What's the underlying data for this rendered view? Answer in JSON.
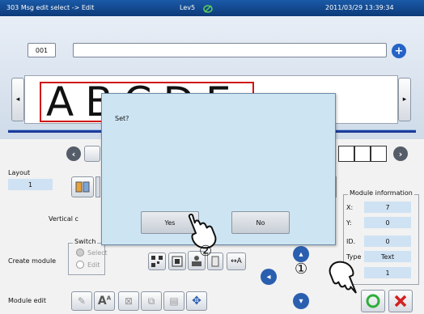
{
  "titlebar": {
    "mode": "303 Msg edit select -> Edit",
    "level": "Lev5",
    "datetime": "2011/03/29 13:39:34"
  },
  "message": {
    "number": "001",
    "text": "",
    "preview_text": "ABCDE"
  },
  "layout": {
    "label": "Layout",
    "value": "1"
  },
  "vertical": {
    "label": "Vertical c"
  },
  "switch": {
    "label": "Switch",
    "options": [
      "Select",
      "Edit"
    ]
  },
  "create_module": {
    "label": "Create module"
  },
  "module_edit": {
    "label": "Module edit"
  },
  "module_info": {
    "title": "Module information",
    "rows": [
      {
        "key": "X:",
        "value": "7"
      },
      {
        "key": "Y:",
        "value": "0"
      },
      {
        "key": "ID.",
        "value": "0"
      },
      {
        "key": "Type",
        "value": "Text"
      },
      {
        "key": "",
        "value": "1"
      }
    ]
  },
  "dialog": {
    "prompt": "Set?",
    "yes_label": "Yes",
    "no_label": "No"
  },
  "annotations": {
    "step1": "①",
    "step2": "②"
  },
  "colors": {
    "title_bar": "#0d3a78",
    "dialog_bg": "#cde5f3",
    "ok": "#2fae3a",
    "cancel": "#d32020",
    "nav_blue": "#2a5fb0"
  }
}
